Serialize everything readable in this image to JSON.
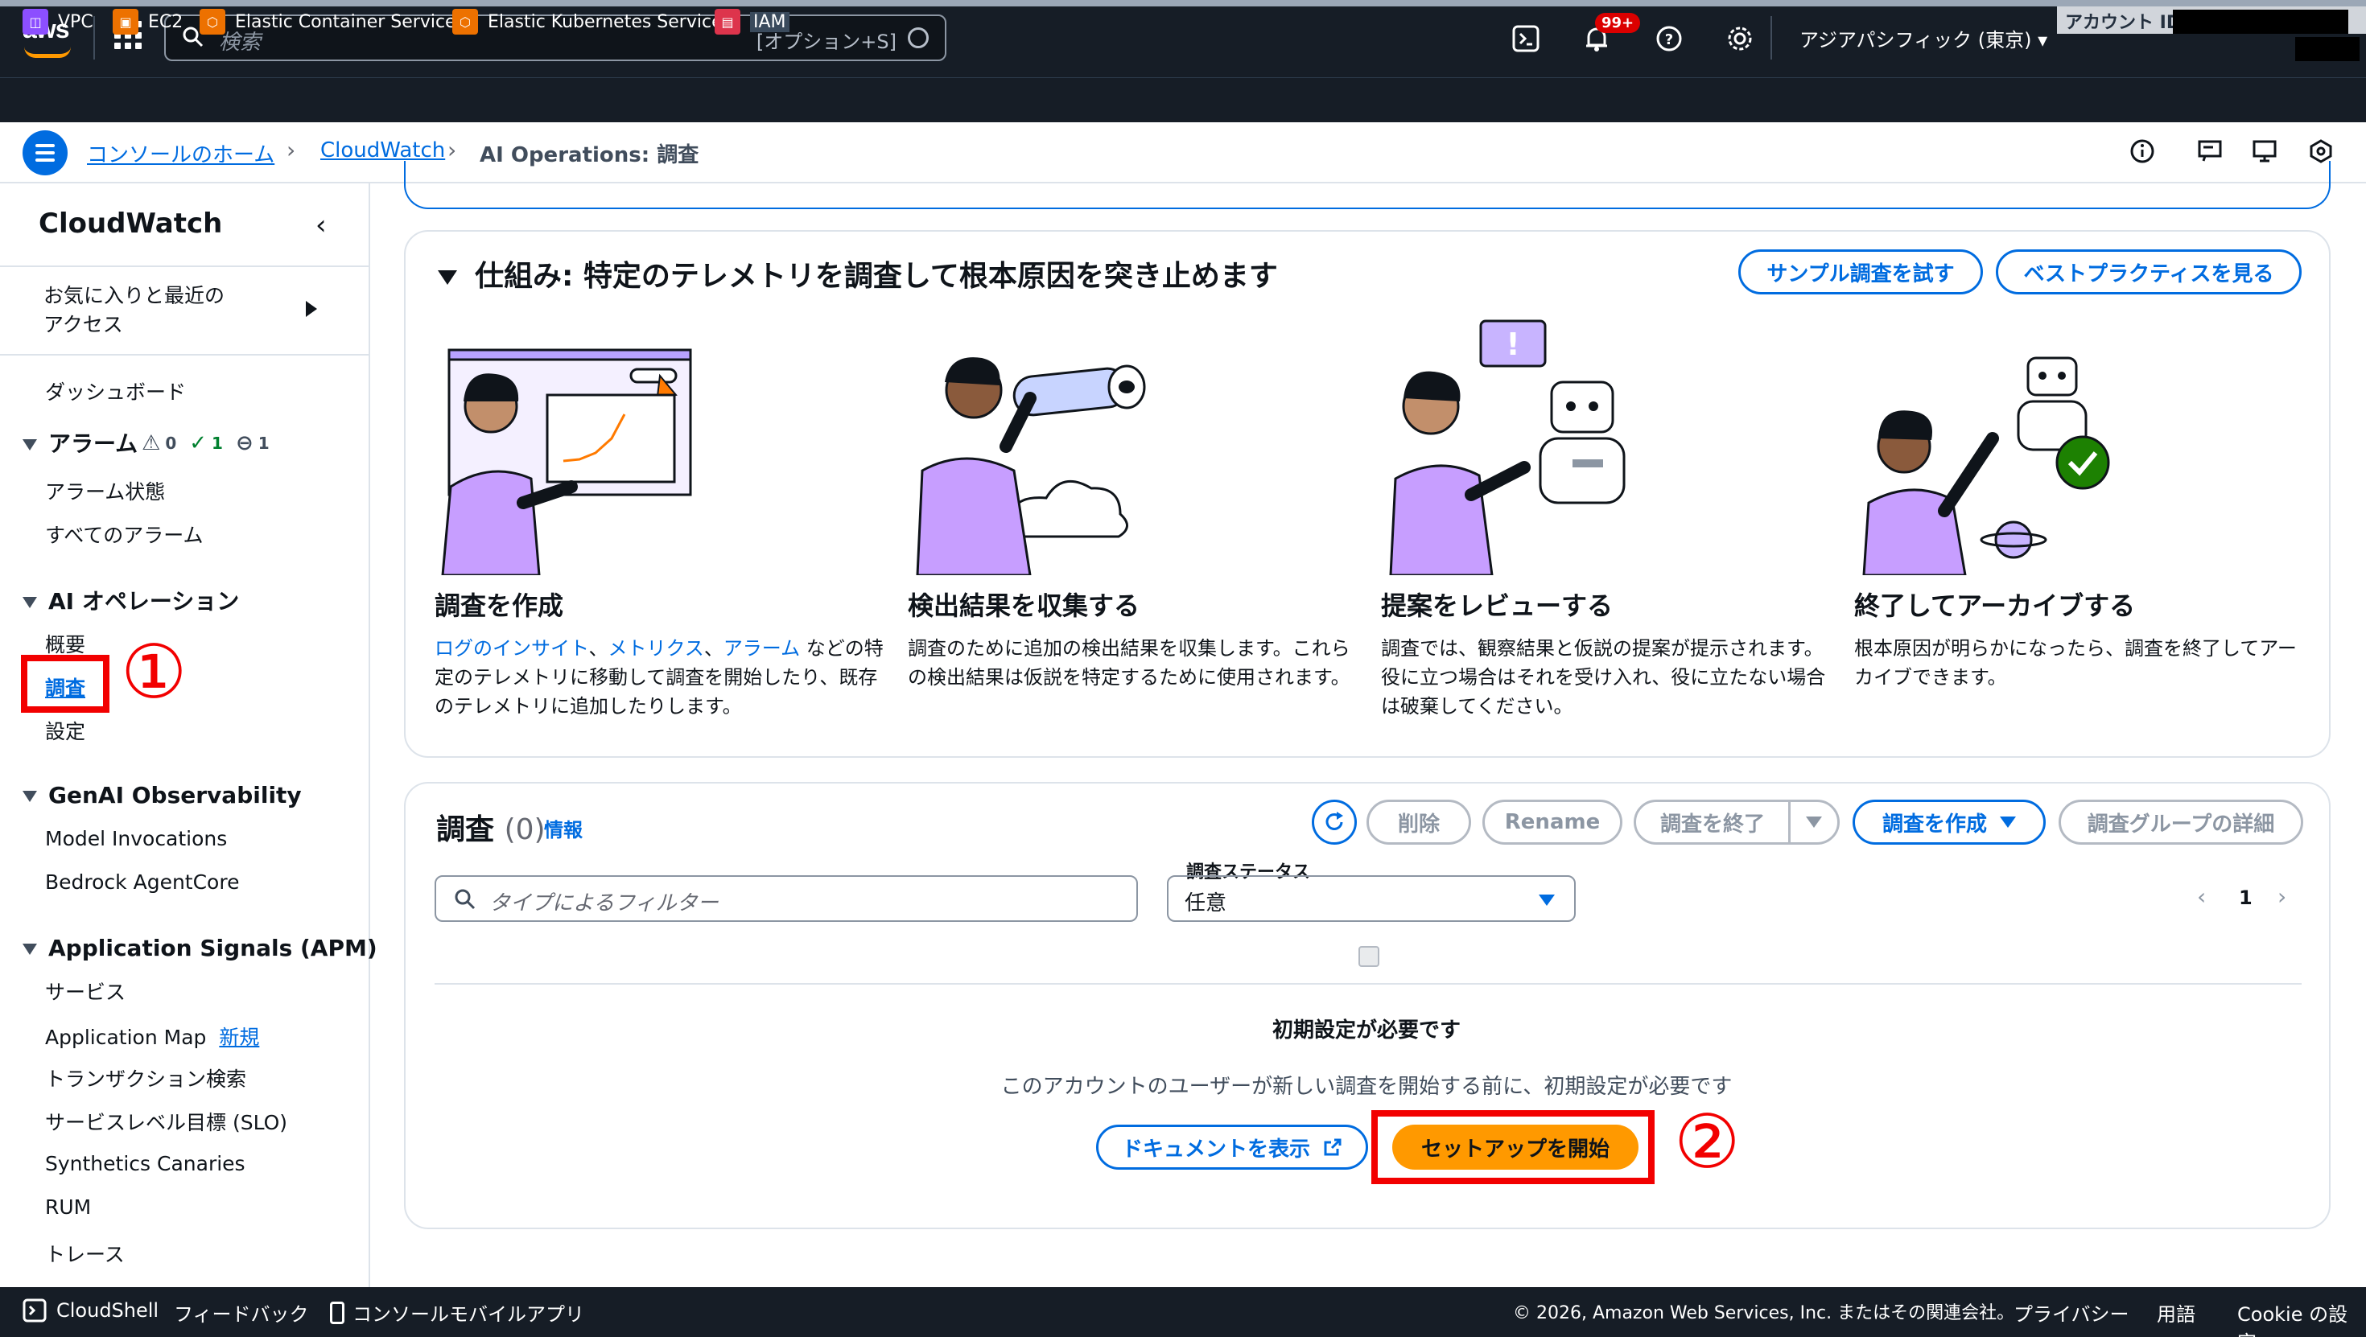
{
  "topnav": {
    "logo": "aws",
    "search_placeholder": "検索",
    "search_shortcut": "[オプション+S]",
    "notification_badge": "99+",
    "region": "アジアパシフィック (東京) ▾",
    "account_label": "アカウント ID:"
  },
  "favorites": [
    {
      "label": "VPC",
      "color": "#8c4fff",
      "icon": "vpc-icon"
    },
    {
      "label": "EC2",
      "color": "#ed7100",
      "icon": "ec2-icon"
    },
    {
      "label": "Elastic Container Service",
      "color": "#ed7100",
      "icon": "ecs-icon"
    },
    {
      "label": "Elastic Kubernetes Service",
      "color": "#ed7100",
      "icon": "eks-icon"
    },
    {
      "label": "IAM",
      "color": "#dd344c",
      "icon": "iam-icon"
    }
  ],
  "breadcrumb": {
    "home": "コンソールのホーム",
    "service": "CloudWatch",
    "current": "AI Operations: 調査"
  },
  "sidebar": {
    "title": "CloudWatch",
    "favorites_label_1": "お気に入りと最近の",
    "favorites_label_2": "アクセス",
    "dashboard": "ダッシュボード",
    "alarms": {
      "label": "アラーム",
      "alarm_count": "0",
      "ok_count": "1",
      "insufficient_count": "1",
      "items": [
        "アラーム状態",
        "すべてのアラーム"
      ]
    },
    "ai_ops": {
      "label": "AI オペレーション",
      "items": [
        "概要",
        "調査",
        "設定"
      ]
    },
    "genai": {
      "label": "GenAI Observability",
      "items": [
        "Model Invocations",
        "Bedrock AgentCore"
      ]
    },
    "app_signals": {
      "label": "Application Signals (APM)",
      "items": [
        "サービス",
        "Application Map",
        "トランザクション検索",
        "サービスレベル目標 (SLO)",
        "Synthetics Canaries",
        "RUM",
        "トレース"
      ],
      "new_badge": "新規"
    },
    "annotation_1": "①"
  },
  "how_it_works": {
    "title": "仕組み: 特定のテレメトリを調査して根本原因を突き止めます",
    "try_sample": "サンプル調査を試す",
    "best_practices": "ベストプラクティスを見る",
    "steps": [
      {
        "title": "調査を作成",
        "link1": "ログのインサイト",
        "sep1": "、",
        "link2": "メトリクス",
        "sep2": "、",
        "link3": "アラーム",
        "rest": " などの特定のテレメトリに移動して調査を開始したり、既存のテレメトリに追加したりします。"
      },
      {
        "title": "検出結果を収集する",
        "desc": "調査のために追加の検出結果を収集します。これらの検出結果は仮説を特定するために使用されます。"
      },
      {
        "title": "提案をレビューする",
        "desc": "調査では、観察結果と仮説の提案が提示されます。役に立つ場合はそれを受け入れ、役に立たない場合は破棄してください。"
      },
      {
        "title": "終了してアーカイブする",
        "desc": "根本原因が明らかになったら、調査を終了してアーカイブできます。"
      }
    ]
  },
  "investigations": {
    "title": "調査",
    "count": "(0)",
    "info": "情報",
    "delete": "削除",
    "rename": "Rename",
    "end": "調査を終了",
    "create": "調査を作成",
    "group_details": "調査グループの詳細",
    "filter_placeholder": "タイプによるフィルター",
    "status_label": "調査ステータス",
    "status_value": "任意",
    "page": "1",
    "empty_title": "初期設定が必要です",
    "empty_desc": "このアカウントのユーザーが新しい調査を開始する前に、初期設定が必要です",
    "docs_button": "ドキュメントを表示",
    "setup_button": "セットアップを開始",
    "annotation_2": "②"
  },
  "footer": {
    "cloudshell": "CloudShell",
    "feedback": "フィードバック",
    "mobile": "コンソールモバイルアプリ",
    "copyright": "© 2026, Amazon Web Services, Inc. またはその関連会社。",
    "privacy": "プライバシー",
    "terms": "用語",
    "cookie": "Cookie の設定"
  }
}
